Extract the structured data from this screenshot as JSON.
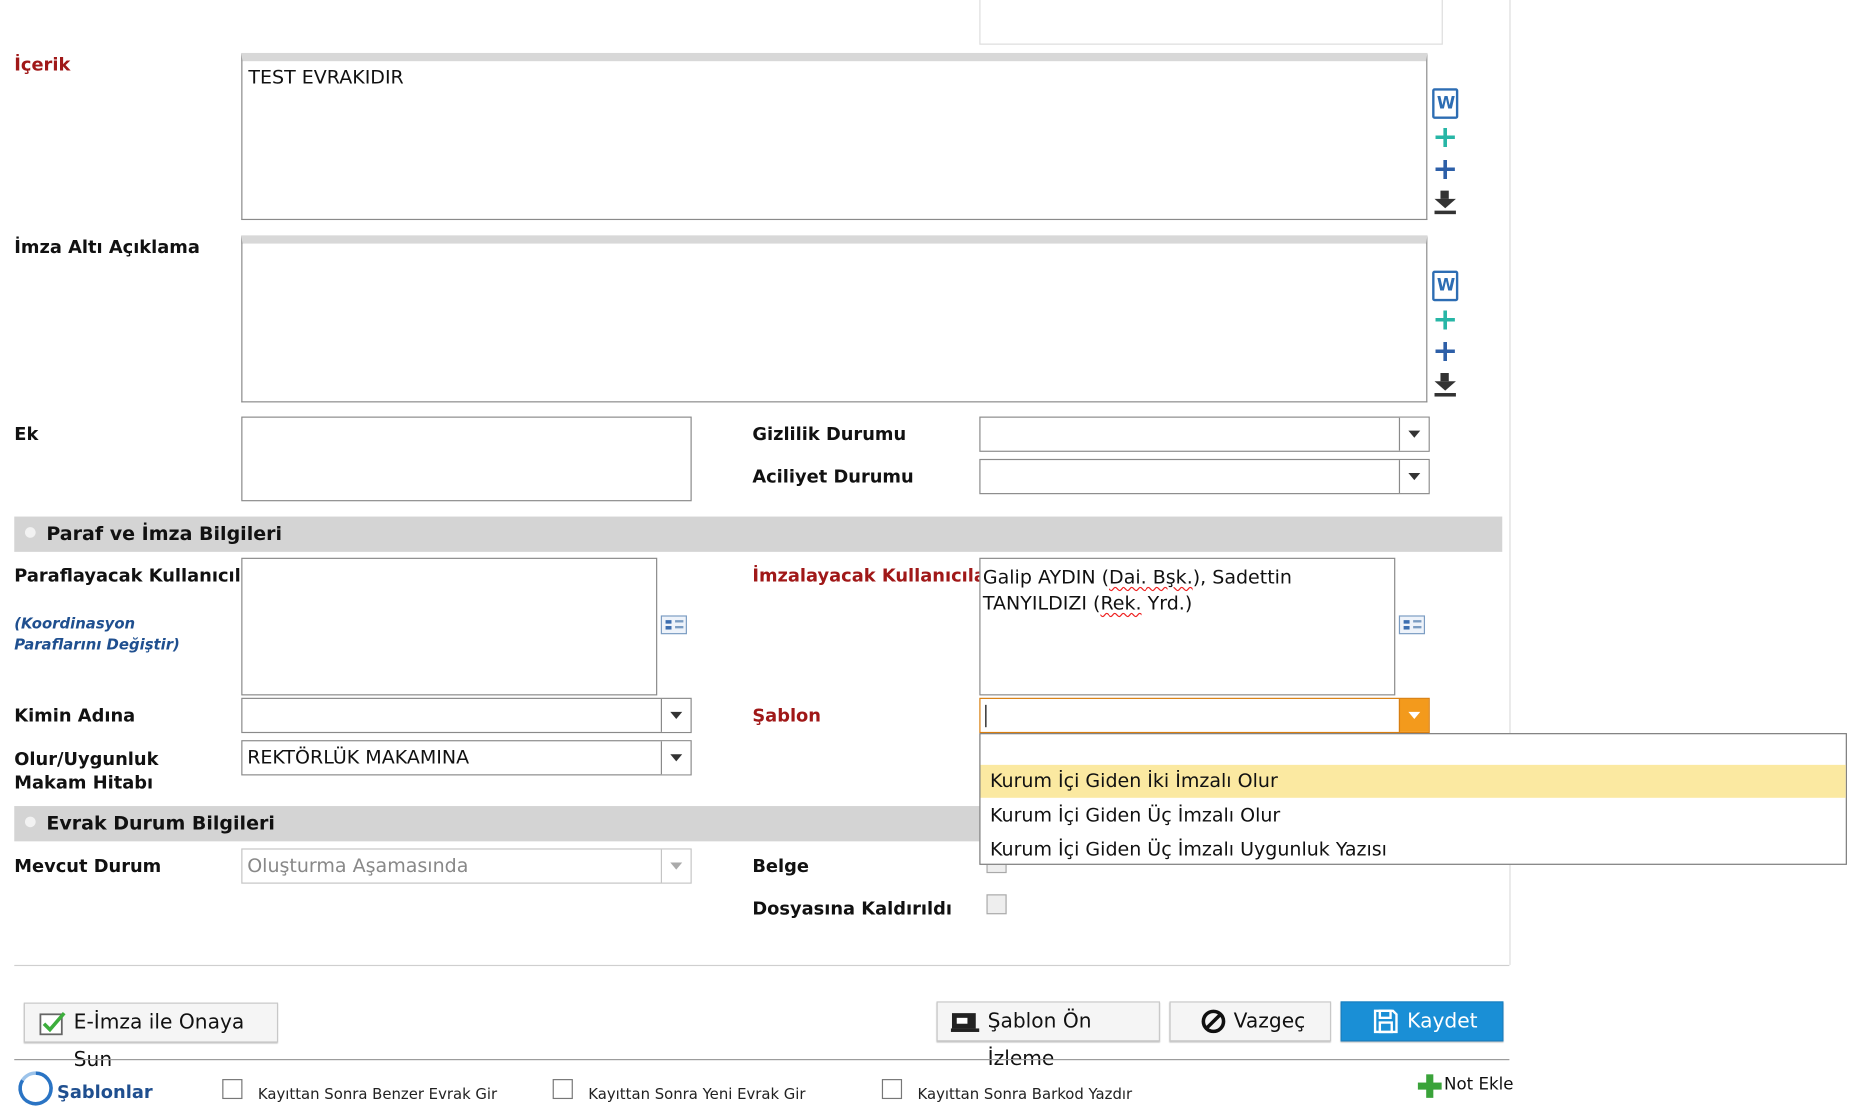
{
  "form": {
    "icerik_label": "İçerik",
    "icerik_value": "TEST EVRAKIDIR",
    "imza_alti_label": "İmza Altı Açıklama",
    "imza_alti_value": "",
    "ek_label": "Ek",
    "gizlilik_label": "Gizlilik Durumu",
    "gizlilik_value": "",
    "aciliyet_label": "Aciliyet Durumu",
    "aciliyet_value": ""
  },
  "paraf_section": {
    "title": "Paraf ve İmza Bilgileri",
    "paraflayacak_label": "Paraflayacak Kullanıcılar",
    "koordinasyon_link": "(Koordinasyon Paraflarını Değiştir)",
    "imzalayacak_label": "İmzalayacak Kullanıcılar",
    "imzalayacak_line1_a": "Galip AYDIN (",
    "imzalayacak_line1_b": "Dai. Bşk.",
    "imzalayacak_line1_c": "), Sadettin",
    "imzalayacak_line2_a": "TANYILDIZI (",
    "imzalayacak_line2_b": "Rek.",
    "imzalayacak_line2_c": " Yrd.)",
    "kimin_adina_label": "Kimin Adına",
    "kimin_adina_value": "",
    "sablon_label": "Şablon",
    "sablon_value": "",
    "olur_label": "Olur/Uygunluk Makam Hitabı",
    "olur_value": "REKTÖRLÜK MAKAMINA"
  },
  "sablon_dropdown": {
    "options": [
      "Kurum İçi Giden İki İmzalı Olur",
      "Kurum İçi Giden Üç İmzalı Olur",
      "Kurum İçi Giden Üç İmzalı Uygunluk Yazısı"
    ],
    "highlighted_index": 0
  },
  "evrak_section": {
    "title": "Evrak Durum Bilgileri",
    "mevcut_durum_label": "Mevcut Durum",
    "mevcut_durum_value": "Oluşturma Aşamasında",
    "belge_label": "Belge",
    "dosyasina_label": "Dosyasına Kaldırıldı"
  },
  "actions": {
    "eimza_button": "E-İmza ile Onaya Sun",
    "sablon_onizleme_button": "Şablon Ön İzleme",
    "vazgec_button": "Vazgeç",
    "kaydet_button": "Kaydet"
  },
  "footer": {
    "sablonlar_link": "Şablonlar",
    "opt_benzer": "Kayıttan Sonra Benzer Evrak Gir",
    "opt_yeni": "Kayıttan Sonra Yeni Evrak Gir",
    "opt_barkod": "Kayıttan Sonra Barkod Yazdır",
    "not_ekle": "Not Ekle"
  },
  "icons": [
    "word-doc-icon",
    "add-teal-icon",
    "add-blue-icon",
    "download-icon",
    "list-picker-icon",
    "edit-check-icon",
    "screen-icon",
    "cancel-icon",
    "save-icon",
    "refresh-icon",
    "plus-green-icon"
  ],
  "colors": {
    "label_red": "#a01818",
    "section_bg": "#d4d4d4",
    "primary_button": "#1a8fd6",
    "dropdown_highlight": "#fbe9a1",
    "active_select_arrow": "#f39a1c"
  }
}
